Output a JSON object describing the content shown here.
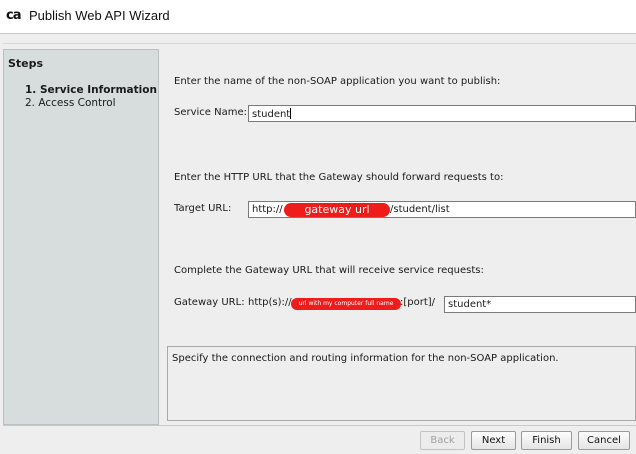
{
  "window": {
    "logo_text": "ca",
    "title": "Publish Web API Wizard"
  },
  "steps": {
    "heading": "Steps",
    "items": [
      {
        "label": "1. Service Information",
        "active": true
      },
      {
        "label": "2. Access Control",
        "active": false
      }
    ]
  },
  "service": {
    "prompt": "Enter the name of the non-SOAP application you want to publish:",
    "label": "Service Name:",
    "value": "student"
  },
  "target": {
    "prompt": "Enter the HTTP URL that the Gateway should forward requests to:",
    "label": "Target URL:",
    "prefix": "http://",
    "redacted_text": "gateway url",
    "suffix": "/student/list"
  },
  "gateway": {
    "prompt": "Complete the Gateway URL that will receive service requests:",
    "label": "Gateway URL:",
    "prefix": "http(s)://",
    "redacted_text": "url with my computer full name",
    "port_text": ":[port]/",
    "path_value": "student*"
  },
  "description": {
    "text": "Specify the connection and routing information for the non-SOAP application."
  },
  "buttons": {
    "back": "Back",
    "next": "Next",
    "finish": "Finish",
    "cancel": "Cancel"
  },
  "colors": {
    "redaction": "#ef1c1c",
    "steps_panel": "#d6dddc",
    "dialog_background": "#eeeeee"
  }
}
